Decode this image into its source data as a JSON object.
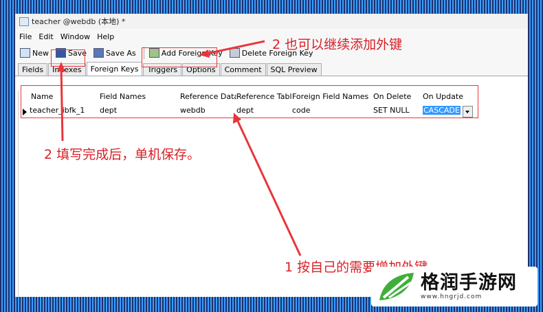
{
  "window": {
    "title": "teacher @webdb (本地) *"
  },
  "menu": [
    "File",
    "Edit",
    "Window",
    "Help"
  ],
  "toolbar": {
    "new": "New",
    "save": "Save",
    "save_as": "Save As",
    "add_fk": "Add Foreign Key",
    "delete_fk": "Delete Foreign Key"
  },
  "tabs": [
    "Fields",
    "Indexes",
    "Foreign Keys",
    "Triggers",
    "Options",
    "Comment",
    "SQL Preview"
  ],
  "active_tab": "Foreign Keys",
  "grid": {
    "headers": [
      "Name",
      "Field Names",
      "Reference Data",
      "Reference Tabl",
      "Foreign Field Names",
      "On Delete",
      "On Update"
    ],
    "row": [
      "teacher_ibfk_1",
      "dept",
      "webdb",
      "dept",
      "code",
      "SET NULL",
      "CASCADE"
    ]
  },
  "annotations": {
    "n1": "1 按自己的需要增加外键",
    "n2": "2 填写完成后，单机保存。",
    "n3": "2 也可以继续添加外键"
  },
  "watermark": {
    "title": "格润手游网",
    "url": "www.hngrjd.com"
  },
  "colors": {
    "annotation": "#d81f26",
    "selection": "#3399ff"
  }
}
